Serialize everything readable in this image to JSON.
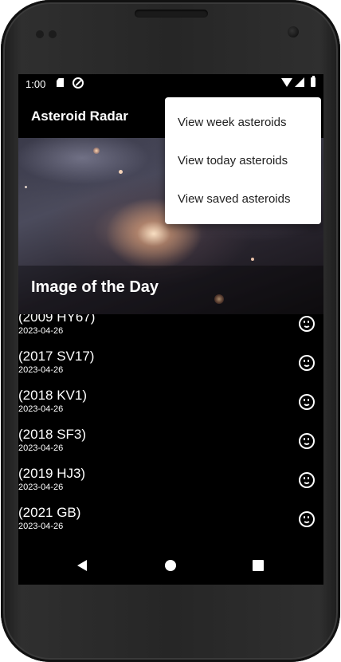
{
  "status_bar": {
    "time": "1:00",
    "icons": [
      "sd-card-icon",
      "sync-icon",
      "wifi-icon",
      "signal-icon",
      "battery-icon"
    ]
  },
  "app_bar": {
    "title": "Asteroid Radar"
  },
  "overflow_menu": {
    "items": [
      {
        "label": "View week asteroids"
      },
      {
        "label": "View today asteroids"
      },
      {
        "label": "View saved asteroids"
      }
    ]
  },
  "image_of_day": {
    "label": "Image of the Day"
  },
  "asteroids": [
    {
      "name": "(2009 HY67)",
      "date": "2023-04-26",
      "status_icon": "smiley-icon"
    },
    {
      "name": "(2017 SV17)",
      "date": "2023-04-26",
      "status_icon": "smiley-icon"
    },
    {
      "name": "(2018 KV1)",
      "date": "2023-04-26",
      "status_icon": "smiley-icon"
    },
    {
      "name": "(2018 SF3)",
      "date": "2023-04-26",
      "status_icon": "smiley-icon"
    },
    {
      "name": "(2019 HJ3)",
      "date": "2023-04-26",
      "status_icon": "smiley-icon"
    },
    {
      "name": "(2021 GB)",
      "date": "2023-04-26",
      "status_icon": "smiley-icon"
    }
  ],
  "nav_bar": {
    "icons": [
      "back-icon",
      "home-icon",
      "recents-icon"
    ]
  },
  "colors": {
    "background": "#000000",
    "text": "#ffffff",
    "menu_background": "#ffffff",
    "menu_text": "#212121"
  }
}
